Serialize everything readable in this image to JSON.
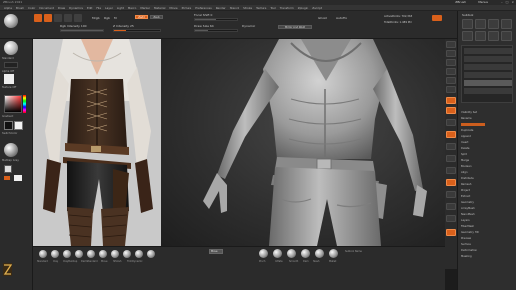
{
  "window": {
    "title": "ZBrush 2021",
    "account_label": "ZBrush",
    "menu_label": "Menus",
    "window_controls": [
      "–",
      "□",
      "×"
    ]
  },
  "menubar": {
    "items": [
      "Alpha",
      "Brush",
      "Color",
      "Document",
      "Draw",
      "Dynamics",
      "Edit",
      "File",
      "Layer",
      "Light",
      "Macro",
      "Marker",
      "Material",
      "Movie",
      "Picture",
      "Preferences",
      "Render",
      "Stencil",
      "Stroke",
      "Texture",
      "Tool",
      "Transform",
      "Zplugin",
      "Zscript"
    ]
  },
  "topshelf": {
    "mrgb": "Mrgb",
    "rgb": "Rgb",
    "m": "M",
    "zadd": "Zadd",
    "zsub": "Zsub",
    "focal_shift": "Focal Shift 0",
    "draw_size": "Draw Size 64",
    "dynamic": "Dynamic",
    "active_points": "ActivePoints: 702,363",
    "total_points": "TotalPoints: 1.489 Mil",
    "z_intensity": "Z Intensity 25",
    "rgb_intensity": "Rgb Intensity 100",
    "mirror": "Mirror And Weld",
    "ghost": "Ghost",
    "auto_fix": "AutoFix"
  },
  "lefttray": {
    "brush_label": "Standard",
    "alpha_label": "Alpha Off",
    "texture_label": "Texture Off",
    "material_label": "MatCap Gray",
    "gradient": "Gradient",
    "switch_color": "SwitchColor"
  },
  "rightpanel": {
    "title": "Subtool",
    "items": [
      "Visibility Set",
      "Rename",
      "Duplicate",
      "Append",
      "Insert",
      "Delete",
      "Split",
      "Merge",
      "Boolean",
      "Align",
      "Distribute",
      "Remesh",
      "Project",
      "Extract",
      "Geometry",
      "ArrayMesh",
      "NanoMesh",
      "Layers",
      "FiberMesh",
      "Geometry HD",
      "Preview",
      "Surface",
      "Deformation",
      "Masking"
    ]
  },
  "vtools": {
    "labels": [
      "BPR",
      "SPix",
      "Scroll",
      "Zoom",
      "Actual",
      "AAHalf",
      "Persp",
      "Floor",
      "Local",
      "Frame",
      "Move",
      "Scale",
      "Rotate",
      "Transp",
      "Solo",
      "Xpose"
    ]
  },
  "bottomshelf": {
    "brushes": [
      "Standard",
      "Clay",
      "ClayBuildup",
      "DamStandard",
      "Move",
      "hPolish",
      "TrimDynamic",
      "Pinch",
      "Inflate",
      "Smooth",
      "Dam",
      "Slash",
      "Mallet"
    ],
    "center_label": "Move",
    "right_label": "Subtool Name"
  },
  "colors": {
    "accent": "#d9601b",
    "panel": "#2b2b2b",
    "viewport": "#2f2f2f",
    "reference_bg": "#c8c8c8"
  }
}
